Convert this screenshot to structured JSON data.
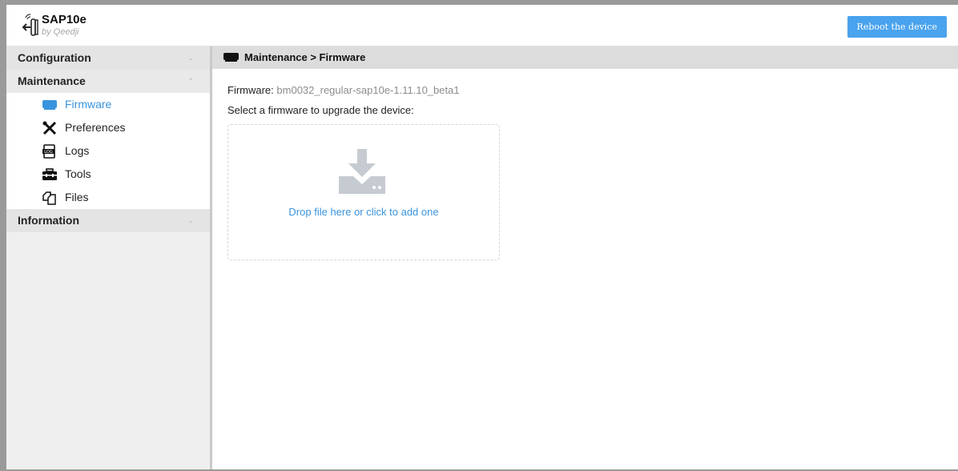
{
  "app": {
    "title": "SAP10e",
    "subtitle": "by Qeedji",
    "logo_icon": "hand-signal-logo-icon"
  },
  "header": {
    "reboot_label": "Reboot the device",
    "accent_color": "#4aa3ee"
  },
  "sidebar": {
    "sections": [
      {
        "label": "Configuration",
        "expanded": false
      },
      {
        "label": "Maintenance",
        "expanded": true
      },
      {
        "label": "Information",
        "expanded": false
      }
    ],
    "maintenance_items": [
      {
        "label": "Firmware",
        "icon": "firmware-icon",
        "active": true
      },
      {
        "label": "Preferences",
        "icon": "preferences-tools-icon",
        "active": false
      },
      {
        "label": "Logs",
        "icon": "log-file-icon",
        "active": false
      },
      {
        "label": "Tools",
        "icon": "toolbox-icon",
        "active": false
      },
      {
        "label": "Files",
        "icon": "files-icon",
        "active": false
      }
    ]
  },
  "main": {
    "breadcrumb": "Maintenance > Firmware",
    "breadcrumb_icon": "firmware-icon",
    "firmware_label": "Firmware:",
    "firmware_value": "bm0032_regular-sap10e-1.11.10_beta1",
    "select_prompt": "Select a firmware to upgrade the device:",
    "dropzone": {
      "icon": "download-to-drive-icon",
      "text": "Drop file here or click to add one"
    }
  }
}
